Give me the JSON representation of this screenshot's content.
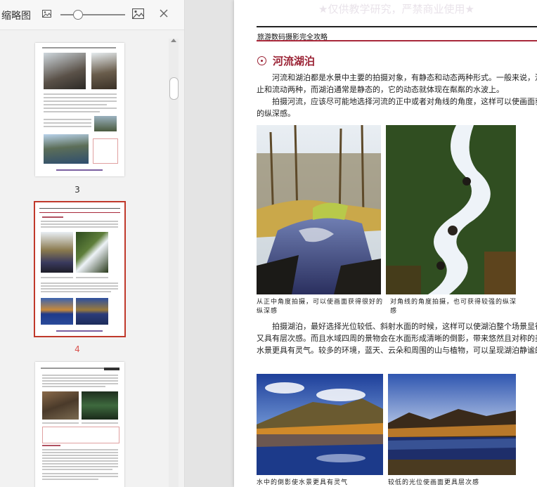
{
  "sidebar": {
    "title": "缩略图",
    "zoom_level": 0.25,
    "pages": [
      {
        "label": "3",
        "selected": false
      },
      {
        "label": "4",
        "selected": true
      }
    ]
  },
  "document": {
    "watermark": "★仅供教学研究，严禁商业使用★",
    "book_title": "旅游数码摄影完全攻略",
    "section_title": "河流湖泊",
    "para1": "河流和湖泊都是水景中主要的拍摄对象，有静态和动态两种形式。一般来说，河流有静止和流动两种，而湖泊通常是静态的，它的动态就体现在粼粼的水波上。",
    "para2": "拍摄河流，应该尽可能地选择河流的正中或者对角线的角度，这样可以使画面获得更强的纵深感。",
    "caption1": "从正中角度拍摄，可以使画面获得很好的纵深感",
    "caption2": "对角线的角度拍摄，也可获得较强的纵深感",
    "para3": "拍摄湖泊，最好选择光位较低、斜射水面的时候，这样可以使湖泊整个场景显得清晰，又具有层次感。而且水域四周的景物会在水面形成清晰的倒影，带来悠然且对称的美感，使水景更具有灵气。较多的环境，蓝天、云朵和周围的山与植物，可以呈现湖泊静谧的氛围。",
    "caption3": "水中的倒影使水景更具有灵气",
    "caption4": "较低的光位使画面更具层次感"
  },
  "icons": {
    "small_thumb": "image-small-icon",
    "large_thumb": "image-large-icon",
    "close": "close-icon"
  },
  "colors": {
    "accent_red": "#9b2335",
    "selected_thumb": "#c0392b"
  }
}
